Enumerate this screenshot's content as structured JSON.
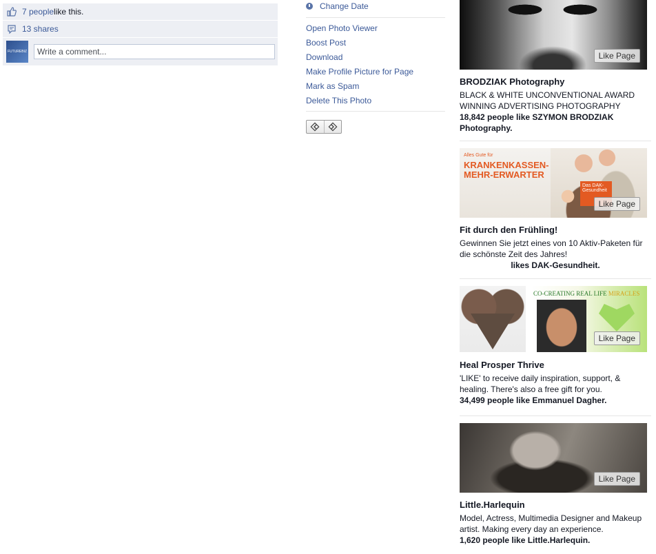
{
  "feedback": {
    "likes_link": "7 people",
    "likes_suffix": " like this.",
    "shares": "13 shares",
    "avatar_text": "FUTUREBIZ",
    "comment_placeholder": "Write a comment..."
  },
  "menu": {
    "change_date": "Change Date",
    "items": [
      "Open Photo Viewer",
      "Boost Post",
      "Download",
      "Make Profile Picture for Page",
      "Mark as Spam",
      "Delete This Photo"
    ]
  },
  "ads": {
    "like_page_label": "Like Page",
    "items": [
      {
        "title": "BRODZIAK Photography",
        "body": "BLACK & WHITE UNCONVENTIONAL AWARD WINNING ADVERTISING PHOTOGRAPHY",
        "social": "18,842 people like SZYMON BRODZIAK Photography."
      },
      {
        "image_text_small": "Alles Gute für",
        "image_headline": "KRANKENKASSEN-\nMEHR-ERWARTER",
        "image_badge": "Das DAK-Gesundheit",
        "title": "Fit durch den Frühling!",
        "body": "Gewinnen Sie jetzt eines von 10 Aktiv-Paketen für die schönste Zeit des Jahres!",
        "social": "likes DAK-Gesundheit."
      },
      {
        "image_text": "CO-CREATING REAL LIFE ",
        "image_text_accent": "MIRACLES",
        "title": "Heal Prosper Thrive",
        "body": "'LIKE' to receive daily inspiration, support, & healing. There's also a free gift for you.",
        "social": "34,499 people like Emmanuel Dagher."
      },
      {
        "title": "Little.Harlequin",
        "body": "Model, Actress, Multimedia Designer and Makeup artist. Making every day an experience.",
        "social": "1,620 people like Little.Harlequin."
      }
    ]
  }
}
